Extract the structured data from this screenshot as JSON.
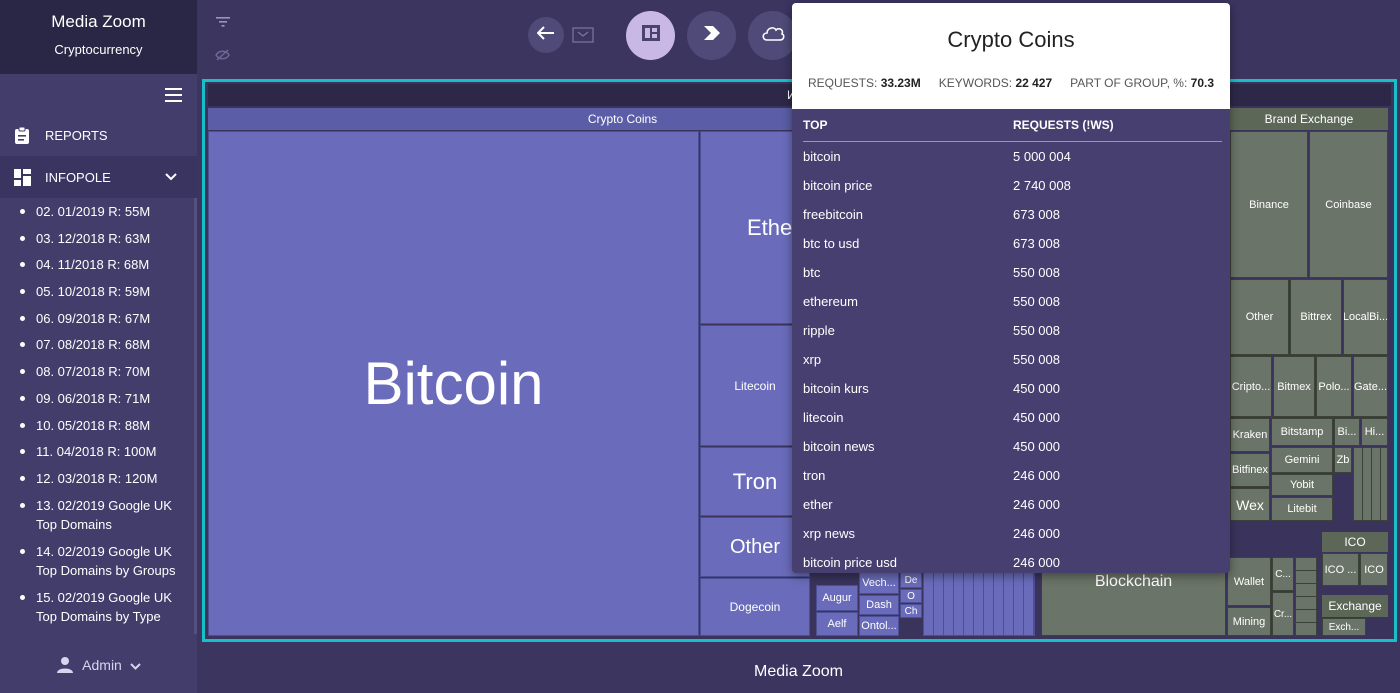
{
  "sidebar": {
    "app_title": "Media Zoom",
    "app_subtitle": "Cryptocurrency",
    "reports_label": "REPORTS",
    "infopole_label": "INFOPOLE",
    "items": [
      "02. 01/2019 R: 55M",
      "03. 12/2018 R: 63M",
      "04. 11/2018 R: 68M",
      "05. 10/2018 R: 59M",
      "06. 09/2018 R: 67M",
      "07. 08/2018 R: 68M",
      "08. 07/2018 R: 70M",
      "09. 06/2018 R: 71M",
      "10. 05/2018 R: 88M",
      "11. 04/2018 R: 100M",
      "12. 03/2018 R: 120M",
      "13. 02/2019 Google UK Top Domains",
      "14. 02/2019 Google UK Top Domains by Groups",
      "15. 02/2019 Google UK Top Domains by Type"
    ],
    "user_label": "Admin"
  },
  "frame_header": "Инф",
  "treemap": {
    "crypto_coins_header": "Crypto Coins",
    "brand_exchange_header": "Brand Exchange",
    "tiles": {
      "bitcoin": "Bitcoin",
      "ethereum": "Ether",
      "litecoin": "Litecoin",
      "tron": "Tron",
      "other": "Other",
      "dogecoin": "Dogecoin",
      "augur": "Augur",
      "aelf": "Aelf",
      "vechain": "Vech...",
      "dash": "Dash",
      "ontology": "Ontol...",
      "de": "De",
      "o": "O",
      "ch": "Ch",
      "binance": "Binance",
      "coinbase": "Coinbase",
      "other2": "Other",
      "bittrex": "Bittrex",
      "localbi": "LocalBi...",
      "cripto": "Cripto...",
      "bitmex": "Bitmex",
      "polo": "Polo...",
      "gate": "Gate...",
      "kraken": "Kraken",
      "bitstamp": "Bitstamp",
      "bi": "Bi...",
      "hi": "Hi...",
      "bitfinex": "Bitfinex",
      "gemini": "Gemini",
      "zb": "Zb",
      "yobit": "Yobit",
      "wex": "Wex",
      "litebit": "Litebit",
      "blockchain": "Blockchain",
      "wallet": "Wallet",
      "mining": "Mining",
      "c1": "C...",
      "cr": "Cr...",
      "ico": "ICO",
      "ico2": "ICO ...",
      "ico3": "ICO",
      "exchange": "Exchange",
      "exch": "Exch..."
    }
  },
  "popup": {
    "title": "Crypto Coins",
    "requests_label": "REQUESTS:",
    "requests_value": "33.23M",
    "keywords_label": "KEYWORDS:",
    "keywords_value": "22 427",
    "group_label": "PART OF GROUP, %:",
    "group_value": "70.3",
    "col_top": "TOP",
    "col_requests": "REQUESTS (!WS)",
    "rows": [
      {
        "k": "bitcoin",
        "v": "5 000 004"
      },
      {
        "k": "bitcoin price",
        "v": "2 740 008"
      },
      {
        "k": "freebitcoin",
        "v": "673 008"
      },
      {
        "k": "btc to usd",
        "v": "673 008"
      },
      {
        "k": "btc",
        "v": "550 008"
      },
      {
        "k": "ethereum",
        "v": "550 008"
      },
      {
        "k": "ripple",
        "v": "550 008"
      },
      {
        "k": "xrp",
        "v": "550 008"
      },
      {
        "k": "bitcoin kurs",
        "v": "450 000"
      },
      {
        "k": "litecoin",
        "v": "450 000"
      },
      {
        "k": "bitcoin news",
        "v": "450 000"
      },
      {
        "k": "tron",
        "v": "246 000"
      },
      {
        "k": "ether",
        "v": "246 000"
      },
      {
        "k": "xrp news",
        "v": "246 000"
      },
      {
        "k": "bitcoin price usd",
        "v": "246 000"
      }
    ]
  },
  "footer_label": "Media Zoom",
  "colors": {
    "accent": "#17bfc9",
    "crypto_tile": "#6a6cbb",
    "exchange_tile": "#6b7468",
    "sidebar": "#433d6b"
  }
}
